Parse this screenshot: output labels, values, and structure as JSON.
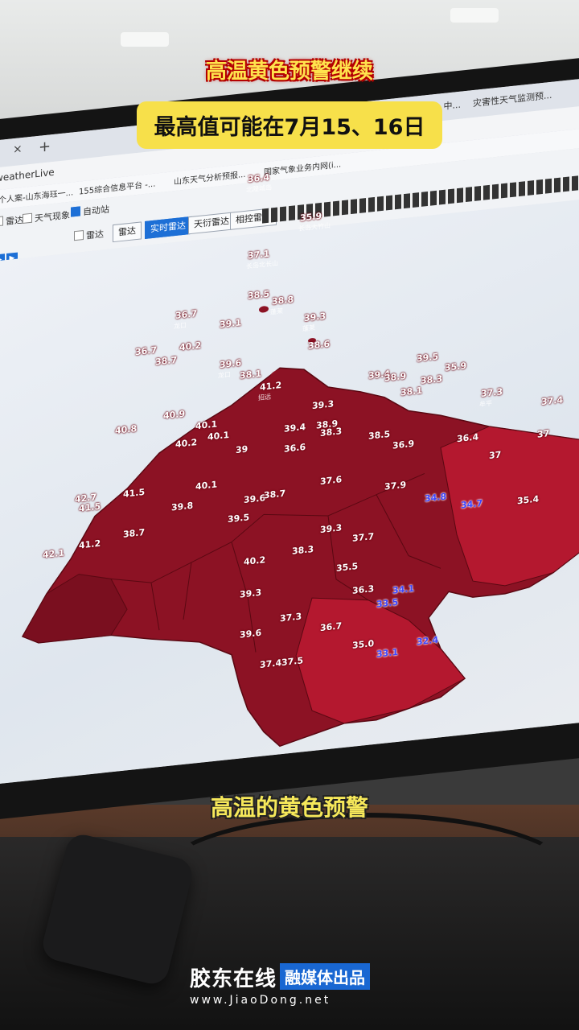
{
  "overlay": {
    "headline": "高温黄色预警继续",
    "subheadline": "最高值可能在7月15、16日",
    "caption": "高温的黄色预警"
  },
  "brand": {
    "name": "胶东在线",
    "tag": "融媒体出品",
    "url": "www.JiaoDong.net"
  },
  "browser": {
    "tabs": [
      "天气雷达 V3.0 - 中...",
      "灾害性天气监测预..."
    ],
    "address": "weatherLive",
    "bookmarks": [
      "个人案-山东海珏一...",
      "155综合信息平台 -...",
      "山东天气分析预报...",
      "国家气象业务内网(i..."
    ]
  },
  "toolbar": {
    "checkboxes": [
      {
        "label": "雷达",
        "checked": false
      },
      {
        "label": "天气现象",
        "checked": false
      },
      {
        "label": "自动站",
        "checked": true
      },
      {
        "label": "雷达",
        "checked": false
      }
    ],
    "buttons": [
      "雷达",
      "实时雷达",
      "天衍雷达",
      "相控雷达"
    ],
    "active_button": "实时雷达"
  },
  "stations": [
    {
      "t": "36.4",
      "name": "北隍城岛"
    },
    {
      "t": "35.9",
      "name": "长岛大竹山"
    },
    {
      "t": "37.1",
      "name": "长岛北长山"
    },
    {
      "t": "38.5",
      "name": ""
    },
    {
      "t": "38.8",
      "name": "蓬莱"
    },
    {
      "t": "36.7",
      "name": "龙口"
    },
    {
      "t": "39.1",
      "name": ""
    },
    {
      "t": "39.3",
      "name": "蓬莱"
    },
    {
      "t": "36.7",
      "name": ""
    },
    {
      "t": "40.2",
      "name": ""
    },
    {
      "t": "38.7",
      "name": ""
    },
    {
      "t": "38.6",
      "name": ""
    },
    {
      "t": "39.6",
      "name": "龙口"
    },
    {
      "t": "38.1",
      "name": ""
    },
    {
      "t": "41.2",
      "name": "招远"
    },
    {
      "t": "39.5",
      "name": ""
    },
    {
      "t": "35.9",
      "name": ""
    },
    {
      "t": "39.4",
      "name": ""
    },
    {
      "t": "38.9",
      "name": ""
    },
    {
      "t": "38.3",
      "name": ""
    },
    {
      "t": "38.1",
      "name": ""
    },
    {
      "t": "40.9",
      "name": ""
    },
    {
      "t": "39.3",
      "name": ""
    },
    {
      "t": "38.9",
      "name": ""
    },
    {
      "t": "40.8",
      "name": ""
    },
    {
      "t": "40.1",
      "name": ""
    },
    {
      "t": "40.1",
      "name": ""
    },
    {
      "t": "37.3",
      "name": "牟平"
    },
    {
      "t": "37.4",
      "name": ""
    },
    {
      "t": "40.2",
      "name": ""
    },
    {
      "t": "39.4",
      "name": ""
    },
    {
      "t": "38.3",
      "name": ""
    },
    {
      "t": "38.5",
      "name": ""
    },
    {
      "t": "39",
      "name": ""
    },
    {
      "t": "36.6",
      "name": ""
    },
    {
      "t": "36.9",
      "name": ""
    },
    {
      "t": "36.4",
      "name": ""
    },
    {
      "t": "37",
      "name": ""
    },
    {
      "t": "37",
      "name": ""
    },
    {
      "t": "42.7",
      "name": ""
    },
    {
      "t": "41.5",
      "name": ""
    },
    {
      "t": "41.5",
      "name": ""
    },
    {
      "t": "40.1",
      "name": ""
    },
    {
      "t": "37.6",
      "name": ""
    },
    {
      "t": "39.8",
      "name": ""
    },
    {
      "t": "39.6",
      "name": ""
    },
    {
      "t": "38.7",
      "name": ""
    },
    {
      "t": "37.9",
      "name": ""
    },
    {
      "t": "34.8",
      "name": ""
    },
    {
      "t": "34.7",
      "name": ""
    },
    {
      "t": "35.4",
      "name": ""
    },
    {
      "t": "42.1",
      "name": ""
    },
    {
      "t": "41.2",
      "name": ""
    },
    {
      "t": "38.7",
      "name": ""
    },
    {
      "t": "39.5",
      "name": ""
    },
    {
      "t": "39.3",
      "name": ""
    },
    {
      "t": "37.7",
      "name": ""
    },
    {
      "t": "40.2",
      "name": ""
    },
    {
      "t": "38.3",
      "name": ""
    },
    {
      "t": "35.5",
      "name": ""
    },
    {
      "t": "39.3",
      "name": ""
    },
    {
      "t": "36.3",
      "name": ""
    },
    {
      "t": "34.1",
      "name": ""
    },
    {
      "t": "33.5",
      "name": ""
    },
    {
      "t": "37.3",
      "name": ""
    },
    {
      "t": "39.6",
      "name": ""
    },
    {
      "t": "36.7",
      "name": ""
    },
    {
      "t": "35.0",
      "name": ""
    },
    {
      "t": "37.4",
      "name": ""
    },
    {
      "t": "37.5",
      "name": ""
    },
    {
      "t": "33.1",
      "name": ""
    },
    {
      "t": "32.4",
      "name": ""
    }
  ],
  "colors": {
    "land_hot": "#8c1224",
    "land_hotter": "#7a0f1f",
    "land_warm": "#b4182f",
    "sea": "#e3e8ef",
    "highlight_yellow": "#f7e04a",
    "brand_blue": "#1967d2"
  }
}
